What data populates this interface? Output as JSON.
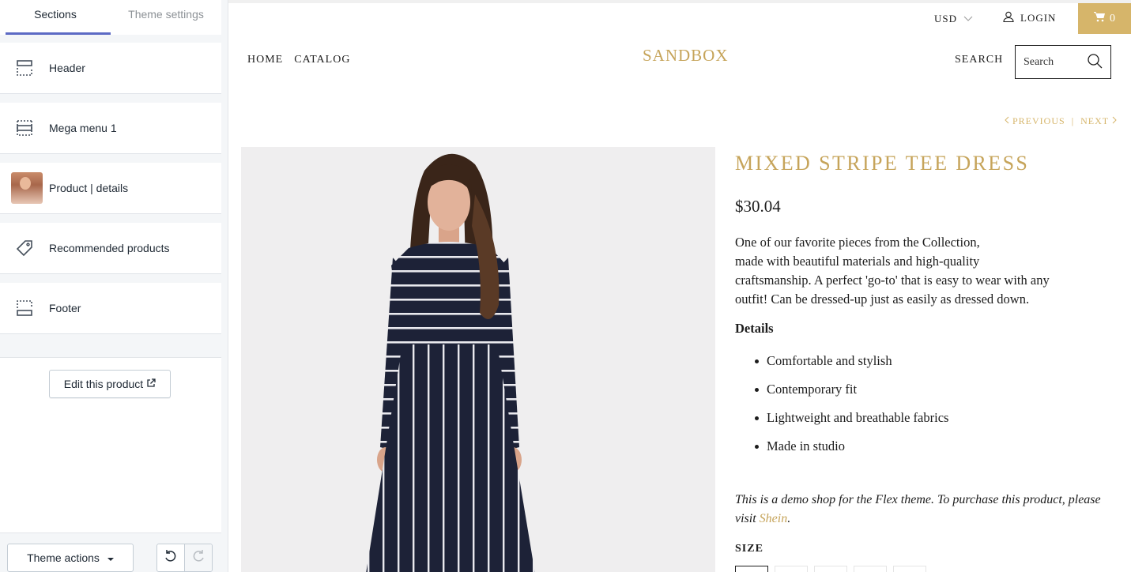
{
  "editor": {
    "tabs": [
      {
        "label": "Sections"
      },
      {
        "label": "Theme settings"
      }
    ],
    "sections": [
      {
        "label": "Header",
        "icon": "header-layout-icon"
      },
      {
        "label": "Mega menu 1",
        "icon": "mega-menu-layout-icon"
      },
      {
        "label": "Product | details",
        "icon": "product-thumbnail"
      },
      {
        "label": "Recommended products",
        "icon": "tag-icon"
      },
      {
        "label": "Footer",
        "icon": "footer-layout-icon"
      }
    ],
    "edit_product_label": "Edit this product",
    "theme_actions_label": "Theme actions",
    "accent": "#5c6ac4"
  },
  "store": {
    "currency": "USD",
    "login": "LOGIN",
    "cart_count": "0",
    "nav": [
      "HOME",
      "CATALOG"
    ],
    "logo": "SANDBOX",
    "search_label": "SEARCH",
    "search_placeholder": "Search",
    "previous": "PREVIOUS",
    "separator": "|",
    "next": "NEXT",
    "brand_color": "#c6a45a",
    "cart_color": "#d6b56a"
  },
  "product": {
    "title": "MIXED STRIPE TEE DRESS",
    "price": "$30.04",
    "description_lines": [
      "One of our favorite pieces from the Collection,",
      "made with beautiful materials and high-quality",
      "craftsmanship. A perfect 'go-to' that is easy to wear with any",
      "outfit! Can be dressed-up just as easily as dressed down."
    ],
    "details_heading": "Details",
    "details": [
      "Comfortable and stylish",
      "Contemporary fit",
      "Lightweight and breathable fabrics",
      "Made in studio"
    ],
    "note_text": "This is a demo shop for the Flex theme. To purchase this product, please visit ",
    "note_link": "Shein",
    "note_end": ".",
    "size_label": "SIZE"
  }
}
